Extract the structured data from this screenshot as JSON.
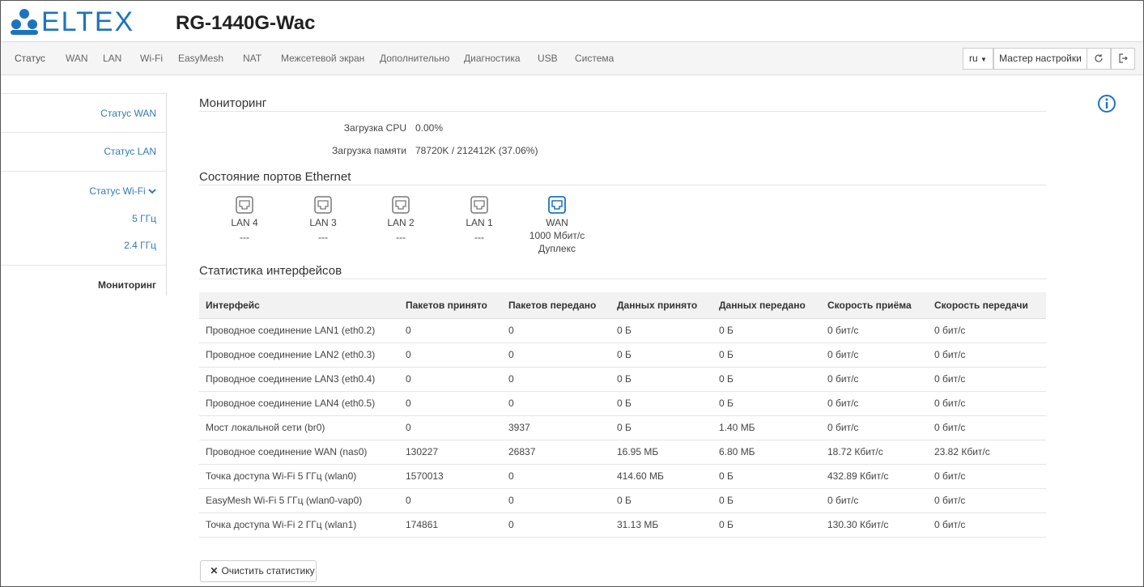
{
  "brand": {
    "logo_text": "ELTEX",
    "model": "RG-1440G-Wac",
    "accent": "#1e73be"
  },
  "nav": {
    "items": [
      {
        "label": "Статус",
        "active": true
      },
      {
        "label": "WAN"
      },
      {
        "label": "LAN"
      },
      {
        "label": "Wi-Fi"
      },
      {
        "label": "EasyMesh"
      },
      {
        "label": "NAT"
      },
      {
        "label": "Межсетевой экран"
      },
      {
        "label": "Дополнительно"
      },
      {
        "label": "Диагностика"
      },
      {
        "label": "USB"
      },
      {
        "label": "Система"
      }
    ],
    "lang": "ru",
    "wizard": "Мастер настройки",
    "icons": [
      "refresh-icon",
      "logout-icon"
    ]
  },
  "sidebar": {
    "items": [
      {
        "label": "Статус WAN"
      },
      {
        "label": "Статус LAN"
      },
      {
        "label": "Статус Wi-Fi"
      },
      {
        "label": "5 ГГц"
      },
      {
        "label": "2.4 ГГц"
      },
      {
        "label": "Мониторинг"
      }
    ]
  },
  "monitoring": {
    "title": "Мониторинг",
    "cpu_label": "Загрузка CPU",
    "cpu_value": "0.00%",
    "mem_label": "Загрузка памяти",
    "mem_value": "78720K / 212412K (37.06%)"
  },
  "ports": {
    "title": "Состояние портов Ethernet",
    "items": [
      {
        "name": "LAN 4",
        "status": "---"
      },
      {
        "name": "LAN 3",
        "status": "---"
      },
      {
        "name": "LAN 2",
        "status": "---"
      },
      {
        "name": "LAN 1",
        "status": "---"
      },
      {
        "name": "WAN",
        "status": "1000 Мбит/с",
        "duplex": "Дуплекс"
      }
    ]
  },
  "stats": {
    "title": "Статистика интерфейсов",
    "headers": [
      "Интерфейс",
      "Пакетов принято",
      "Пакетов передано",
      "Данных принято",
      "Данных передано",
      "Скорость приёма",
      "Скорость передачи"
    ],
    "rows": [
      [
        "Проводное соединение LAN1 (eth0.2)",
        "0",
        "0",
        "0 Б",
        "0 Б",
        "0 бит/с",
        "0 бит/с"
      ],
      [
        "Проводное соединение LAN2 (eth0.3)",
        "0",
        "0",
        "0 Б",
        "0 Б",
        "0 бит/с",
        "0 бит/с"
      ],
      [
        "Проводное соединение LAN3 (eth0.4)",
        "0",
        "0",
        "0 Б",
        "0 Б",
        "0 бит/с",
        "0 бит/с"
      ],
      [
        "Проводное соединение LAN4 (eth0.5)",
        "0",
        "0",
        "0 Б",
        "0 Б",
        "0 бит/с",
        "0 бит/с"
      ],
      [
        "Мост локальной сети (br0)",
        "0",
        "3937",
        "0 Б",
        "1.40 МБ",
        "0 бит/с",
        "0 бит/с"
      ],
      [
        "Проводное соединение WAN (nas0)",
        "130227",
        "26837",
        "16.95 МБ",
        "6.80 МБ",
        "18.72 Кбит/с",
        "23.82 Кбит/с"
      ],
      [
        "Точка доступа Wi-Fi 5 ГГц (wlan0)",
        "1570013",
        "0",
        "414.60 МБ",
        "0 Б",
        "432.89 Кбит/с",
        "0 бит/с"
      ],
      [
        "EasyMesh Wi-Fi 5 ГГц (wlan0-vap0)",
        "0",
        "0",
        "0 Б",
        "0 Б",
        "0 бит/с",
        "0 бит/с"
      ],
      [
        "Точка доступа Wi-Fi 2 ГГц (wlan1)",
        "174861",
        "0",
        "31.13 МБ",
        "0 Б",
        "130.30 Кбит/с",
        "0 бит/с"
      ]
    ],
    "clear_label": "Очистить статистику"
  }
}
